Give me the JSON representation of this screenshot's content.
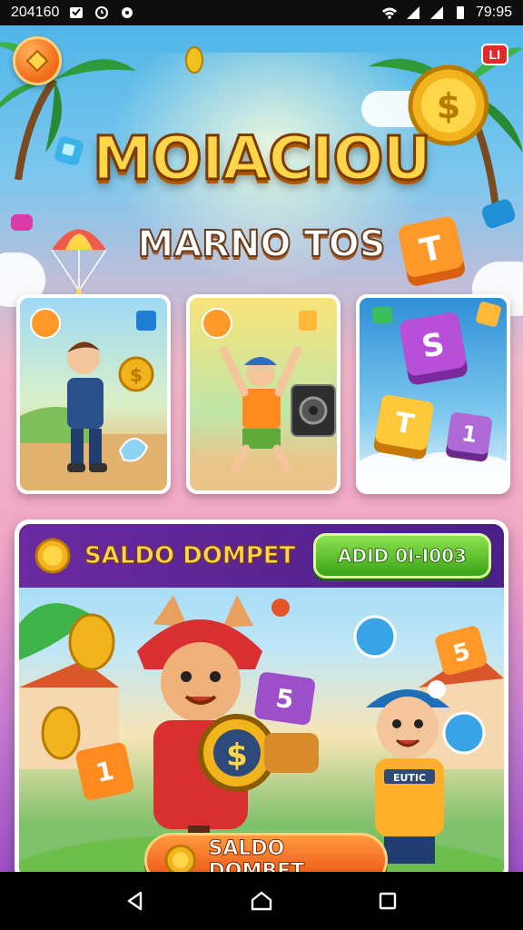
{
  "status_bar": {
    "time_left": "204160",
    "time_right": "79:95",
    "icons": [
      "notification-icon",
      "alarm-icon",
      "dot-icon",
      "wifi-icon",
      "signal-icon",
      "signal-icon-2",
      "battery-icon"
    ]
  },
  "game": {
    "live_badge": "LI",
    "title": "MOIACIOU",
    "subtitle": "MARNO TOS",
    "cards": [
      {
        "name": "player-card",
        "desc_icon": "coin-icon"
      },
      {
        "name": "dancer-card",
        "desc_icon": "speaker-icon"
      },
      {
        "name": "tiles-card",
        "tiles": [
          "S",
          "T",
          "1"
        ]
      }
    ],
    "floating_tile_letter": "T",
    "panel": {
      "header_title": "SALDO DOMPET",
      "id_button_label": "ADID 0I-I003",
      "tile_labels": [
        "5",
        "5",
        "1"
      ],
      "kid_badge": "EUTIC",
      "action_button_label": "SALDO DOMBET"
    }
  },
  "nav_bar": {
    "buttons": [
      "back",
      "home",
      "recents"
    ]
  },
  "colors": {
    "title_gold": "#ffd54a",
    "panel_header_purple": "#6b2aa0",
    "id_button_green": "#3aa317",
    "action_orange": "#e84b12"
  }
}
